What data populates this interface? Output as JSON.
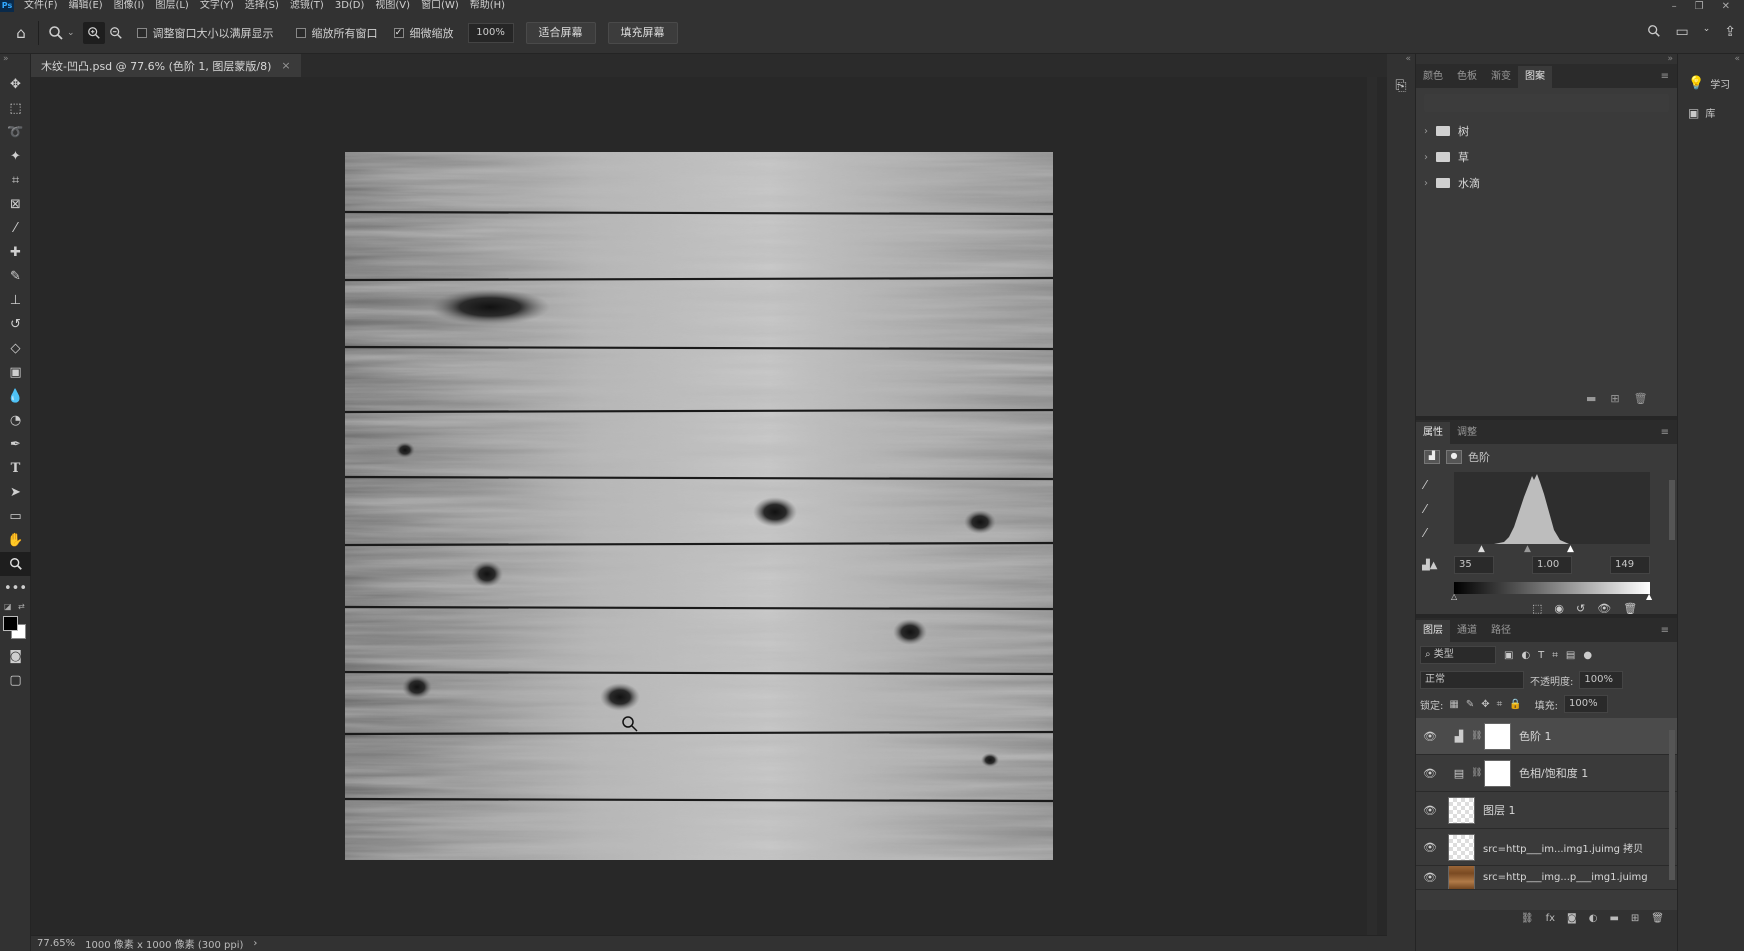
{
  "app": {
    "logo": "Ps"
  },
  "menubar": {
    "items": [
      "文件(F)",
      "编辑(E)",
      "图像(I)",
      "图层(L)",
      "文字(Y)",
      "选择(S)",
      "滤镜(T)",
      "3D(D)",
      "视图(V)",
      "窗口(W)",
      "帮助(H)"
    ]
  },
  "options": {
    "chk_resize": "调整窗口大小以满屏显示",
    "chk_zoom_all": "缩放所有窗口",
    "chk_scrubby": "细微缩放",
    "zoom_value": "100%",
    "fit_screen": "适合屏幕",
    "fill_screen": "填充屏幕"
  },
  "document": {
    "tab_title": "木纹-凹凸.psd @ 77.6% (色阶 1, 图层蒙版/8)",
    "close": "×"
  },
  "status": {
    "zoom": "77.65%",
    "info": "1000 像素 x 1000 像素 (300 ppi)",
    "arrow": "›"
  },
  "patterns_panel": {
    "tabs": [
      "颜色",
      "色板",
      "渐变",
      "图案"
    ],
    "active_tab": "图案",
    "folders": [
      "树",
      "草",
      "水滴"
    ]
  },
  "properties_panel": {
    "tabs": [
      "属性",
      "调整"
    ],
    "active_tab": "属性",
    "adjustment_name": "色阶",
    "input_black": "35",
    "input_gamma": "1.00",
    "input_white": "149"
  },
  "layers_panel": {
    "tabs": [
      "图层",
      "通道",
      "路径"
    ],
    "active_tab": "图层",
    "filter_kind": "类型",
    "blend_mode": "正常",
    "opacity_label": "不透明度:",
    "opacity": "100%",
    "lock_label": "锁定:",
    "fill_label": "填充:",
    "fill": "100%",
    "layers": [
      {
        "name": "色阶 1",
        "type": "levels",
        "selected": true
      },
      {
        "name": "色相/饱和度 1",
        "type": "hue-sat",
        "selected": false
      },
      {
        "name": "图层 1",
        "type": "pixel",
        "selected": false
      },
      {
        "name": "src=http___im...img1.juimg 拷贝",
        "type": "smart",
        "selected": false
      },
      {
        "name": "src=http___img...p___img1.juimg",
        "type": "photo",
        "selected": false
      }
    ]
  },
  "right_strip": {
    "learn": "学习",
    "libraries": "库"
  },
  "colors": {
    "ui_bg": "#323232",
    "canvas_bg": "#282828",
    "accent": "#31a8ff"
  }
}
